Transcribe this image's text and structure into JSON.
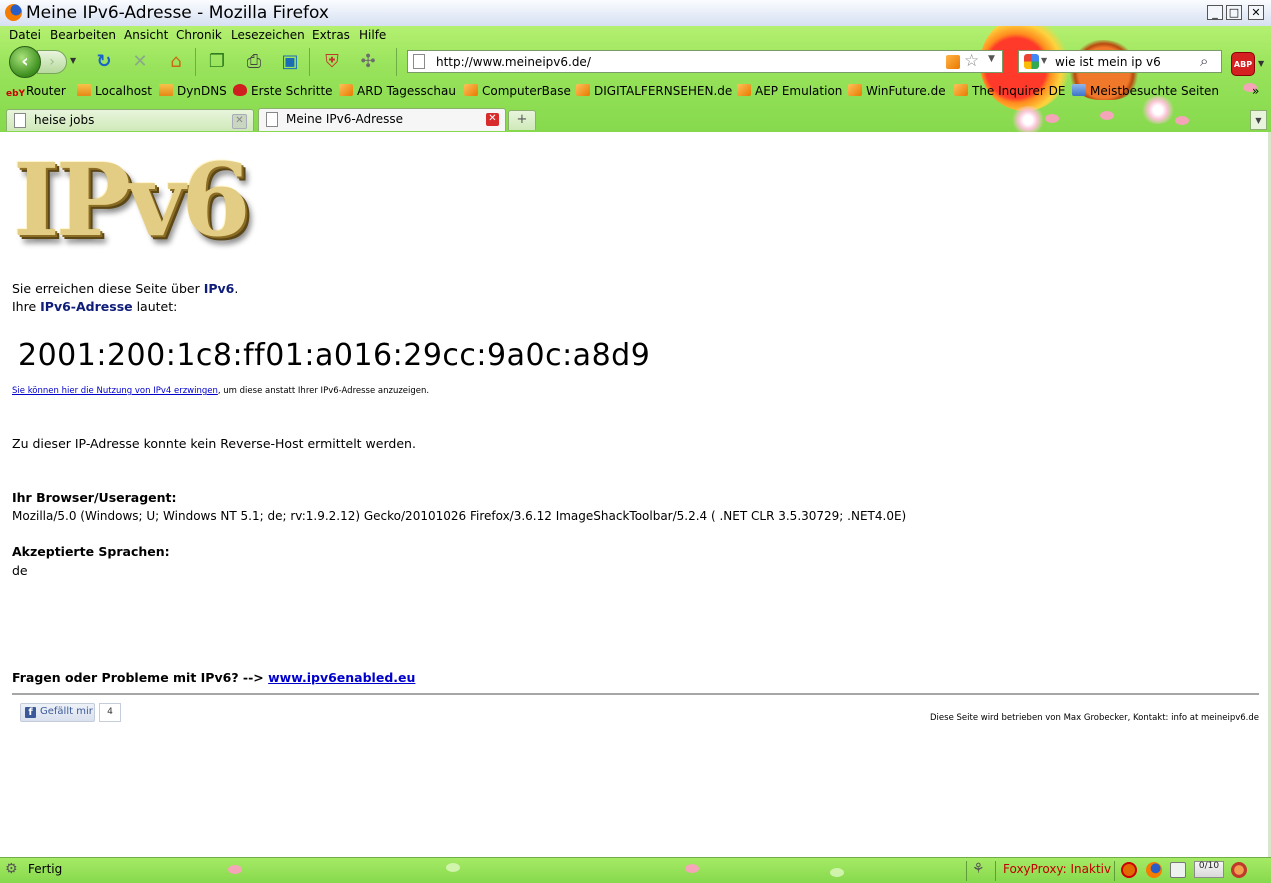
{
  "window": {
    "title": "Meine IPv6-Adresse - Mozilla Firefox",
    "controls": [
      "_",
      "□",
      "✕"
    ]
  },
  "menu": [
    "Datei",
    "Bearbeiten",
    "Ansicht",
    "Chronik",
    "Lesezeichen",
    "Extras",
    "Hilfe"
  ],
  "navbar": {
    "url": "http://www.meineipv6.de/",
    "search_query": "wie ist mein ip v6",
    "adblock_label": "ABP"
  },
  "bookmarks": [
    {
      "label": "Router",
      "icon": "ebay-icon"
    },
    {
      "label": "Localhost",
      "icon": "phpmyadmin-icon"
    },
    {
      "label": "DynDNS",
      "icon": "phpmyadmin-icon"
    },
    {
      "label": "Erste Schritte",
      "icon": "red-bookmark-icon"
    },
    {
      "label": "ARD Tagesschau",
      "icon": "rss-folder-icon"
    },
    {
      "label": "ComputerBase",
      "icon": "rss-folder-icon"
    },
    {
      "label": "DIGITALFERNSEHEN.de",
      "icon": "rss-folder-icon"
    },
    {
      "label": "AEP Emulation",
      "icon": "rss-folder-icon"
    },
    {
      "label": "WinFuture.de",
      "icon": "rss-folder-icon"
    },
    {
      "label": "The Inquirer DE",
      "icon": "rss-folder-icon"
    },
    {
      "label": "Meistbesuchte Seiten",
      "icon": "smart-folder-icon"
    }
  ],
  "bookmarks_overflow": "»",
  "tabs": [
    {
      "label": "heise jobs",
      "active": false
    },
    {
      "label": "Meine IPv6-Adresse",
      "active": true
    }
  ],
  "page": {
    "logo_text": "IPv6",
    "line1_prefix": "Sie erreichen diese Seite über ",
    "line1_strong": "IPv6",
    "line1_suffix": ".",
    "line2_prefix": "Ihre ",
    "line2_strong": "IPv6-Adresse",
    "line2_suffix": " lautet:",
    "ip_address": "2001:200:1c8:ff01:a016:29cc:9a0c:a8d9",
    "ipv4_link": "Sie können hier die Nutzung von IPv4 erzwingen",
    "ipv4_suffix": ", um diese anstatt Ihrer IPv6-Adresse anzuzeigen.",
    "reverse_host": "Zu dieser IP-Adresse konnte kein Reverse-Host ermittelt werden.",
    "ua_heading": "Ihr Browser/Useragent:",
    "ua_value": "Mozilla/5.0 (Windows; U; Windows NT 5.1; de; rv:1.9.2.12) Gecko/20101026 Firefox/3.6.12 ImageShackToolbar/5.2.4 ( .NET CLR 3.5.30729; .NET4.0E)",
    "lang_heading": "Akzeptierte Sprachen:",
    "lang_value": "de",
    "questions_prefix": "Fragen oder Probleme mit IPv6? --> ",
    "questions_link": "www.ipv6enabled.eu",
    "fb_like_label": "Gefällt mir",
    "fb_like_count": "4",
    "footer": "Diese Seite wird betrieben von Max Grobecker, Kontakt: info at meineipv6.de"
  },
  "statusbar": {
    "text": "Fertig",
    "foxyproxy": "FoxyProxy: Inaktiv",
    "counter": "0/10"
  },
  "colors": {
    "theme_green": "#98e35b",
    "strong_navy": "#0f1d7a",
    "link_blue": "#0000cc",
    "foxyproxy_red": "#c00000"
  }
}
